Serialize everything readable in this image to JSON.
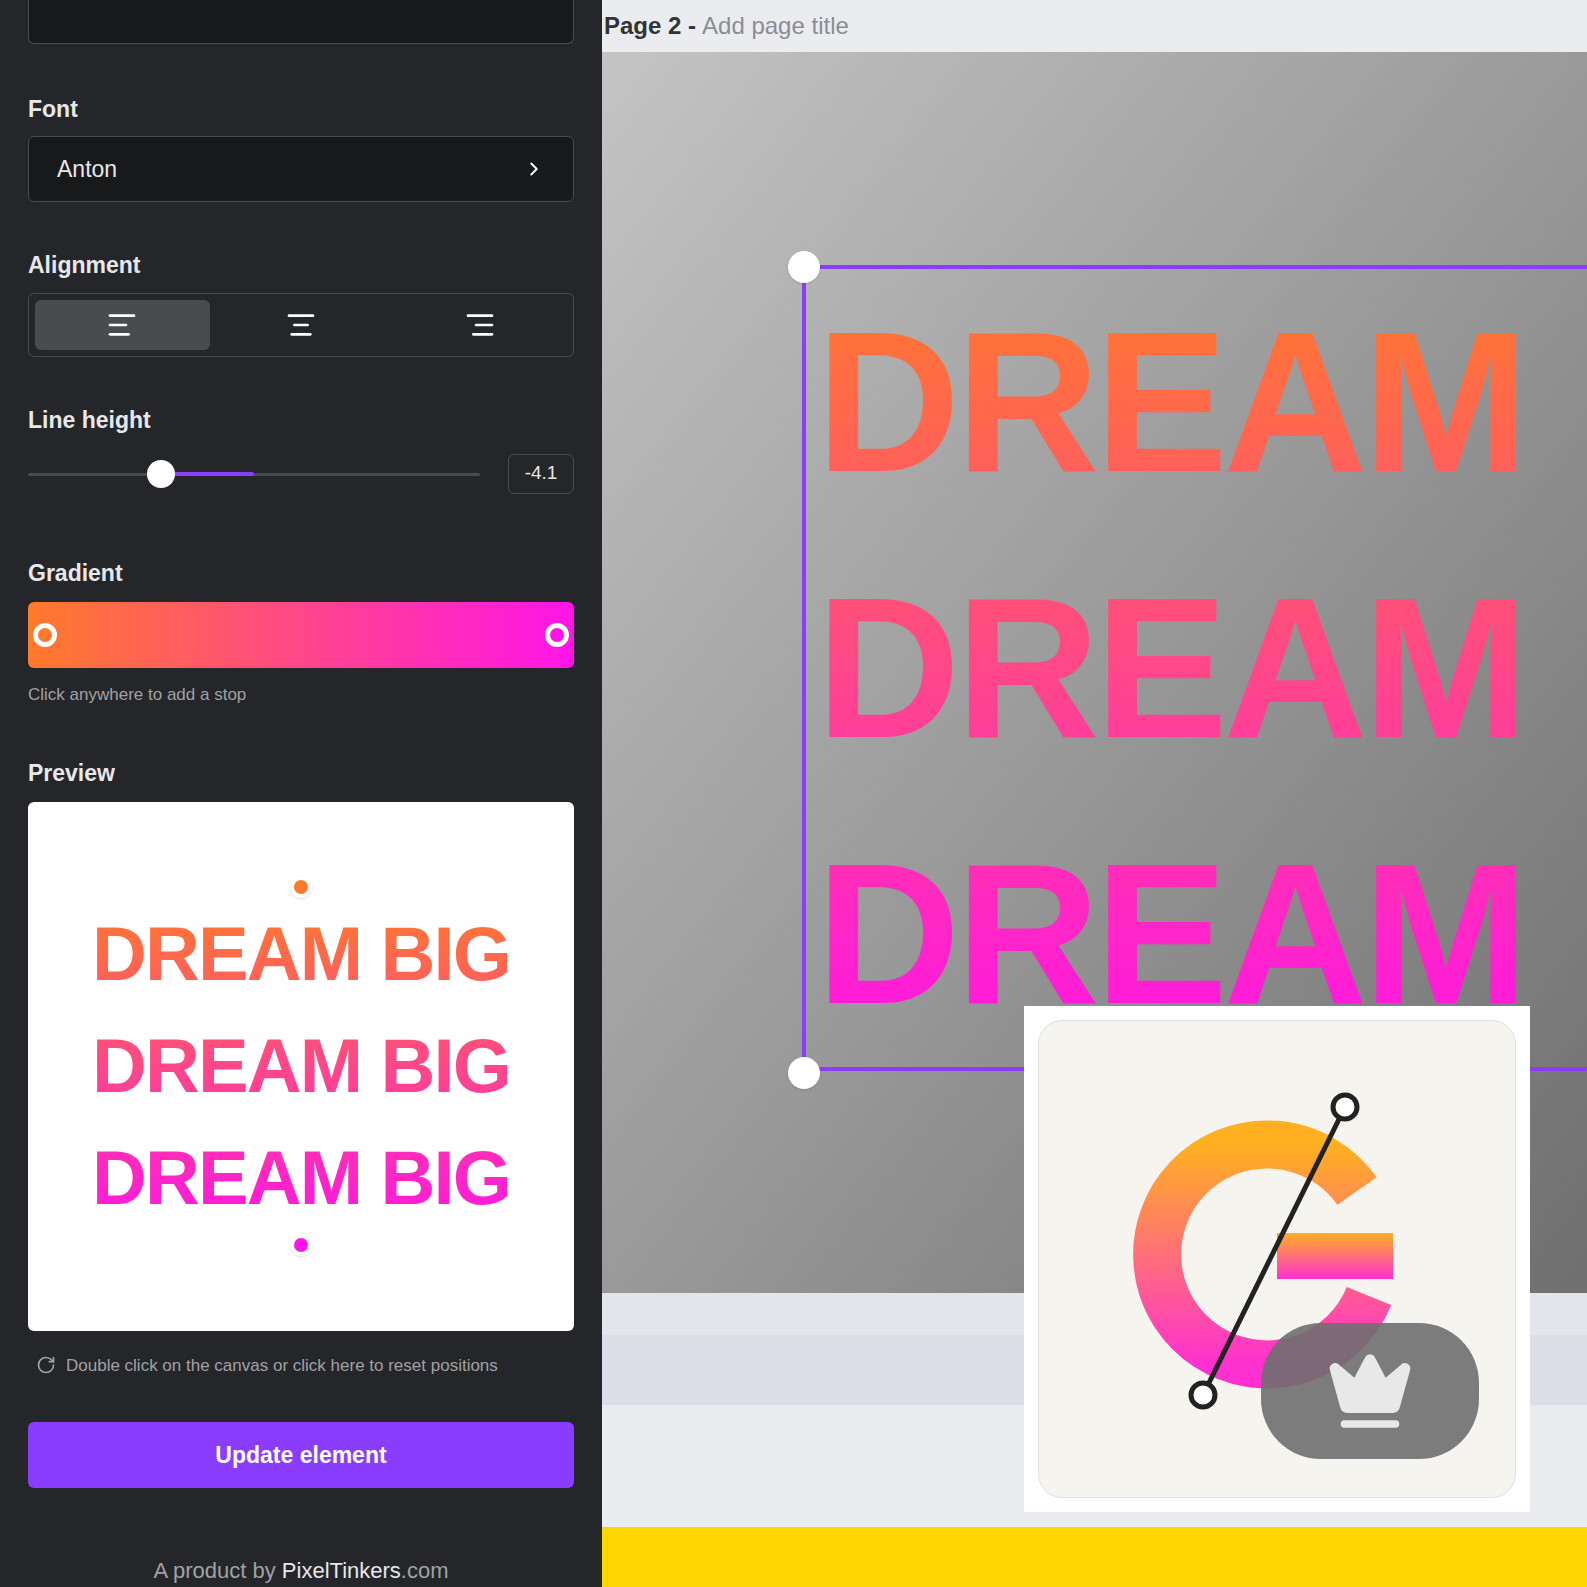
{
  "panel": {
    "font": {
      "label": "Font",
      "value": "Anton"
    },
    "alignment": {
      "label": "Alignment",
      "options": [
        {
          "name": "left",
          "selected": true
        },
        {
          "name": "center",
          "selected": false
        },
        {
          "name": "right",
          "selected": false
        }
      ]
    },
    "line_height": {
      "label": "Line height",
      "level": 0.295,
      "reading": "-4.1"
    },
    "gradient": {
      "label": "Gradient",
      "hint": "Click anywhere to add a stop",
      "stops": [
        {
          "color": "#ff7a2a"
        },
        {
          "color": "#ff14e8"
        }
      ]
    },
    "preview": {
      "label": "Preview",
      "lines": [
        "DREAM BIG",
        "DREAM BIG",
        "DREAM BIG"
      ],
      "reset_hint": "Double click on the canvas or click here to reset positions"
    },
    "update_button": "Update element",
    "footer": {
      "prefix": "A product by ",
      "brand": "PixelTinkers",
      "suffix": ".com"
    }
  },
  "canvas": {
    "page_label": "Page 2 - ",
    "page_title_placeholder": "Add page title",
    "text_lines": [
      "DREAM",
      "DREAM",
      "DREAM"
    ]
  }
}
